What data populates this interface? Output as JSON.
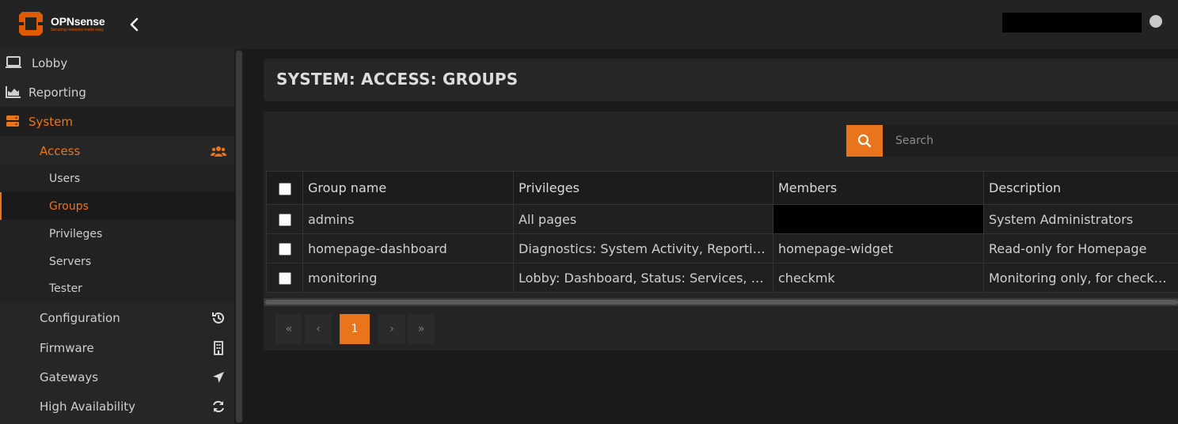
{
  "brand": {
    "name": "OPNsense",
    "tagline": "Securing networks made easy",
    "accent": "#e8741c"
  },
  "sidebar": {
    "items": [
      {
        "label": "Lobby",
        "icon": "laptop-icon"
      },
      {
        "label": "Reporting",
        "icon": "area-chart-icon"
      },
      {
        "label": "System",
        "icon": "server-icon"
      }
    ],
    "system_children": [
      {
        "label": "Access",
        "icon": "users-icon"
      },
      {
        "label": "Configuration",
        "icon": "history-icon"
      },
      {
        "label": "Firmware",
        "icon": "building-icon"
      },
      {
        "label": "Gateways",
        "icon": "location-arrow-icon"
      },
      {
        "label": "High Availability",
        "icon": "refresh-icon"
      }
    ],
    "access_children": [
      "Users",
      "Groups",
      "Privileges",
      "Servers",
      "Tester"
    ],
    "active_item": "Groups"
  },
  "page": {
    "title": "SYSTEM: ACCESS: GROUPS"
  },
  "search": {
    "placeholder": "Search"
  },
  "table": {
    "columns": [
      "Group name",
      "Privileges",
      "Members",
      "Description"
    ],
    "rows": [
      {
        "name": "admins",
        "privileges": "All pages",
        "members": "",
        "description": "System Administrators"
      },
      {
        "name": "homepage-dashboard",
        "privileges": "Diagnostics: System Activity, Reporting: …",
        "members": "homepage-widget",
        "description": "Read-only for Homepage"
      },
      {
        "name": "monitoring",
        "privileges": "Lobby: Dashboard, Status: Services, Sys…",
        "members": "checkmk",
        "description": "Monitoring only, for checkmk a…"
      }
    ]
  },
  "pagination": {
    "first": "«",
    "prev": "‹",
    "current": "1",
    "next": "›",
    "last": "»"
  }
}
